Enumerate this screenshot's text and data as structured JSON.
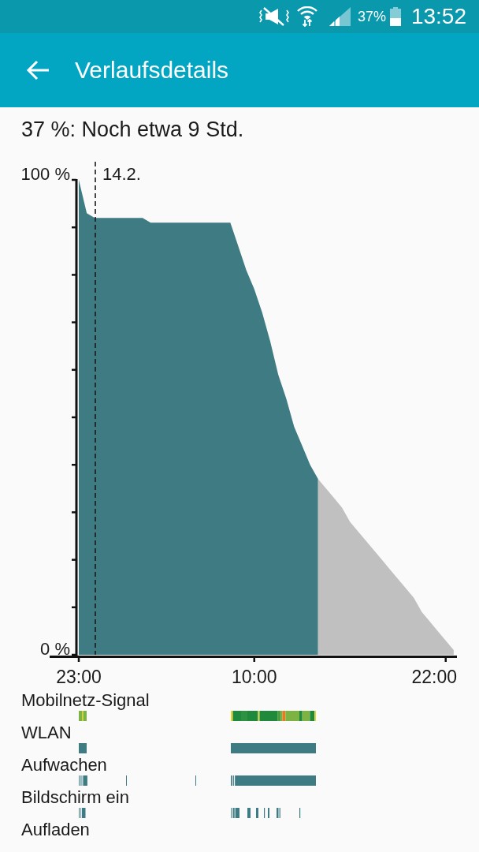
{
  "status_bar": {
    "battery": "37%",
    "time": "13:52"
  },
  "app_bar": {
    "title": "Verlaufsdetails"
  },
  "summary": "37 %: Noch etwa 9 Std.",
  "chart": {
    "chart_data": {
      "type": "area",
      "categories": [
        "23:00",
        null,
        null,
        null,
        null,
        null,
        null,
        null,
        null,
        null,
        null,
        null,
        null,
        null,
        null,
        null,
        null,
        null,
        null,
        null,
        null,
        null,
        "10:00",
        null,
        null,
        null,
        null,
        null,
        null,
        null,
        null,
        null,
        null,
        null,
        null,
        null,
        null,
        null,
        null,
        null,
        null,
        null,
        null,
        null,
        null,
        null,
        "22:00",
        null
      ],
      "series": [
        {
          "color": "#3e7b83",
          "values": [
            100,
            93,
            92,
            92,
            92,
            92,
            92,
            92,
            92,
            91,
            91,
            91,
            91,
            91,
            91,
            91,
            91,
            91,
            91,
            91,
            86,
            81,
            77,
            72,
            66,
            59,
            54,
            48,
            44,
            40,
            37,
            null,
            null,
            null,
            null,
            null,
            null,
            null,
            null,
            null,
            null,
            null,
            null,
            null,
            null,
            null,
            null,
            null
          ]
        },
        {
          "color": "#c0c0c0",
          "values": [
            null,
            null,
            null,
            null,
            null,
            null,
            null,
            null,
            null,
            null,
            null,
            null,
            null,
            null,
            null,
            null,
            null,
            null,
            null,
            null,
            null,
            null,
            null,
            null,
            null,
            null,
            null,
            null,
            null,
            null,
            37,
            35,
            33,
            31,
            28,
            26,
            24,
            22,
            20,
            18,
            16,
            14,
            12,
            9,
            7,
            5,
            3,
            1
          ]
        }
      ],
      "ylim": [
        0,
        100
      ],
      "yticks": [
        {
          "value": 0,
          "label": "0 %"
        },
        {
          "value": 100,
          "label": "100 %"
        }
      ],
      "annotations": [
        "14.2."
      ]
    },
    "timelines": [
      {
        "label": "Mobilnetz-Signal"
      },
      {
        "label": "WLAN"
      },
      {
        "label": "Aufwachen"
      },
      {
        "label": "Bildschirm ein"
      },
      {
        "label": "Aufladen"
      }
    ]
  }
}
